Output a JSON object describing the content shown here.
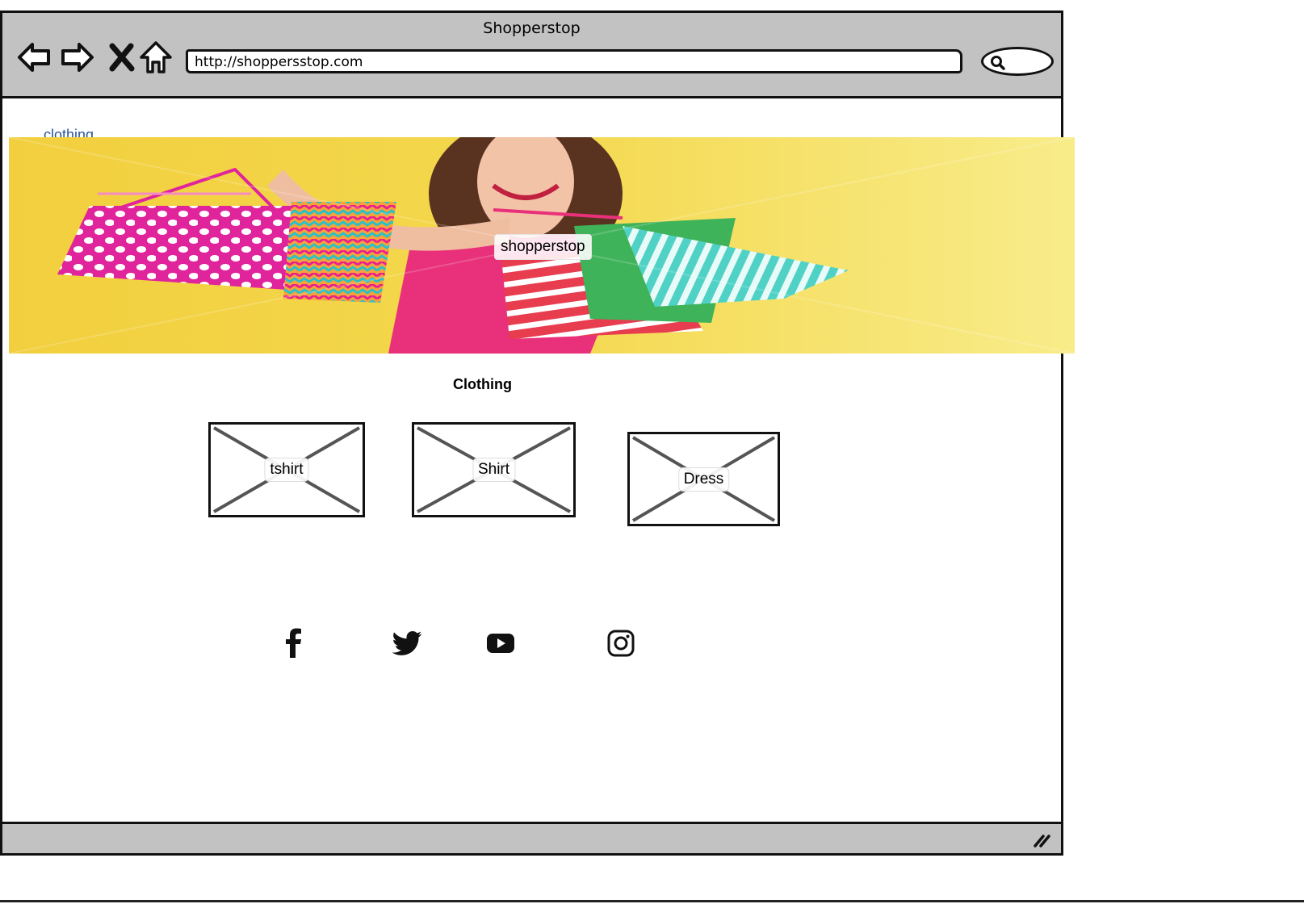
{
  "window": {
    "title": "Shopperstop",
    "url": "http://shoppersstop.com"
  },
  "toolbar": {
    "icons": [
      "back-arrow-icon",
      "forward-arrow-icon",
      "close-x-icon",
      "home-icon",
      "search-icon"
    ]
  },
  "page": {
    "nav_link": "clothing",
    "banner_label": "shopperstop",
    "section_title": "Clothing",
    "products": [
      {
        "label": "tshirt"
      },
      {
        "label": "Shirt"
      },
      {
        "label": "Dress"
      }
    ],
    "social": [
      "facebook-icon",
      "twitter-icon",
      "youtube-icon",
      "instagram-icon"
    ]
  },
  "colors": {
    "chrome": "#c2c2c2",
    "link": "#2a5599",
    "banner_bg": "#f3d44a"
  }
}
